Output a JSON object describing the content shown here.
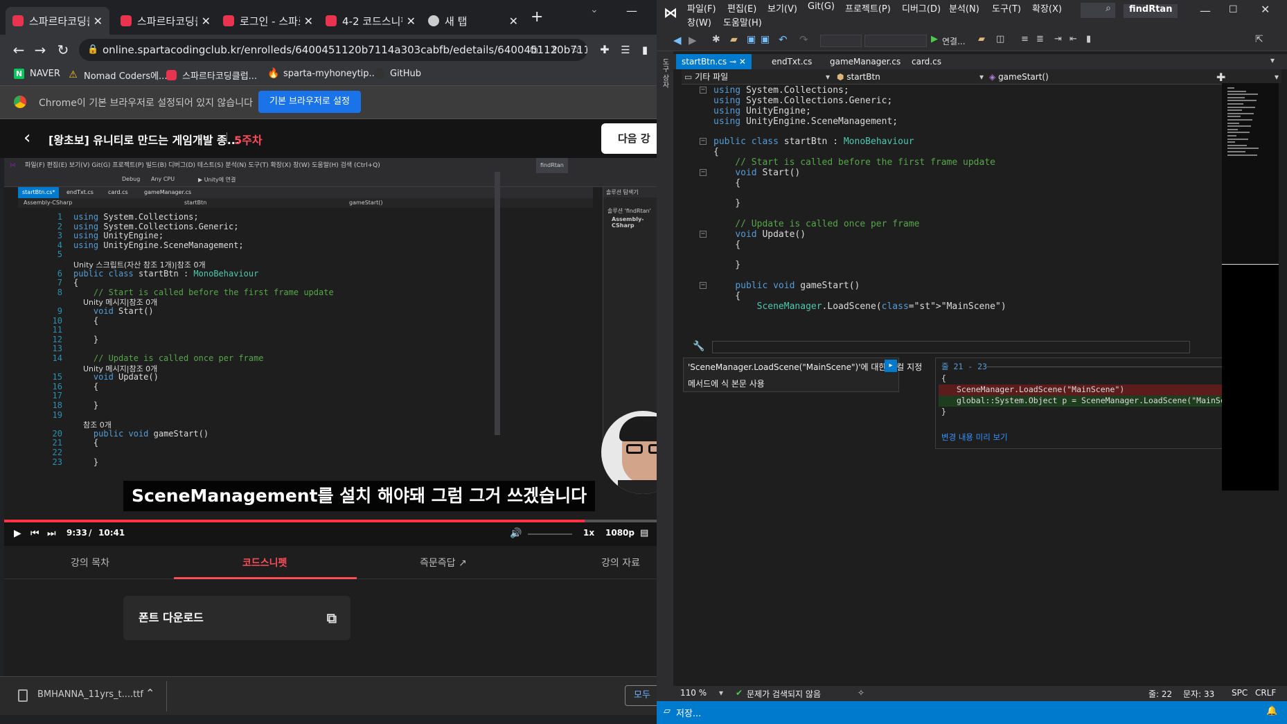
{
  "browser": {
    "tabs": [
      {
        "title": "스파르타코딩클"
      },
      {
        "title": "스파르타코딩클"
      },
      {
        "title": "로그인 - 스파르"
      },
      {
        "title": "4-2 코드스니펫"
      },
      {
        "title": "새 탭"
      }
    ],
    "url": "online.spartacodingclub.kr/enrolleds/6400451120b7114a303cabfb/edetails/6400451120b711...",
    "bookmarks": [
      "NAVER",
      "Nomad Coders에...",
      "스파르타코딩클럽...",
      "sparta-myhoneytip...",
      "GitHub"
    ],
    "infobar_message": "Chrome이 기본 브라우저로 설정되어 있지 않습니다",
    "infobar_button": "기본 브라우저로 설정"
  },
  "lecture": {
    "title": "[왕초보] 유니티로 만드는 게임개발 종...",
    "week": "5주차",
    "next_label": "다음 강의",
    "subtitle": "SceneManagement를 설치 해야돼 그럼 그거 쓰겠습니다",
    "time_current": "9:33",
    "time_sep": "/",
    "time_total": "10:41",
    "progress": 0.89,
    "speed": "1x",
    "quality": "1080p",
    "tabs": [
      "강의 목차",
      "코드스니펫",
      "즉문즉답",
      "강의 자료"
    ],
    "active_tab": 1,
    "font_card": "폰트 다운로드",
    "download_file": "BMHANNA_11yrs_t....ttf",
    "show_all": "모두"
  },
  "video_vs": {
    "menu": "파일(F)  편집(E)  보기(V)  Git(G)  프로젝트(P)  빌드(B)  디버그(D)  테스트(S)  분석(N)  도구(T)  확장(X)  창(W)  도움말(H)   검색 (Ctrl+Q)",
    "project": "findRtan",
    "config": "Debug",
    "platform": "Any CPU",
    "attach": "Unity에 연결",
    "tabs": [
      "startBtn.cs*",
      "endTxt.cs",
      "card.cs",
      "gameManager.cs"
    ],
    "nav": [
      "Assembly-CSharp",
      "startBtn",
      "gameStart()"
    ],
    "side_title": "솔루션 탐색기",
    "side_items": [
      "솔루션 'findRtan'",
      "Assembly-CSharp"
    ],
    "lines": [
      {
        "n": "1",
        "t": "using System.Collections;"
      },
      {
        "n": "2",
        "t": "using System.Collections.Generic;"
      },
      {
        "n": "3",
        "t": "using UnityEngine;"
      },
      {
        "n": "4",
        "t": "using UnityEngine.SceneManagement;"
      },
      {
        "n": "5",
        "t": ""
      },
      {
        "n": "",
        "t": "Unity 스크립트(자산 참조 1개)|참조 0개"
      },
      {
        "n": "6",
        "t": "public class startBtn : MonoBehaviour"
      },
      {
        "n": "7",
        "t": "{"
      },
      {
        "n": "8",
        "t": "    // Start is called before the first frame update"
      },
      {
        "n": "",
        "t": "    Unity 메시지|참조 0개"
      },
      {
        "n": "9",
        "t": "    void Start()"
      },
      {
        "n": "10",
        "t": "    {"
      },
      {
        "n": "11",
        "t": ""
      },
      {
        "n": "12",
        "t": "    }"
      },
      {
        "n": "13",
        "t": ""
      },
      {
        "n": "14",
        "t": "    // Update is called once per frame"
      },
      {
        "n": "",
        "t": "    Unity 메시지|참조 0개"
      },
      {
        "n": "15",
        "t": "    void Update()"
      },
      {
        "n": "16",
        "t": "    {"
      },
      {
        "n": "17",
        "t": ""
      },
      {
        "n": "18",
        "t": "    }"
      },
      {
        "n": "19",
        "t": ""
      },
      {
        "n": "",
        "t": "    참조 0개"
      },
      {
        "n": "20",
        "t": "    public void gameStart()"
      },
      {
        "n": "21",
        "t": "    {"
      },
      {
        "n": "22",
        "t": ""
      },
      {
        "n": "23",
        "t": "    }"
      }
    ]
  },
  "vs": {
    "menu": [
      "파일(F)",
      "편집(E)",
      "보기(V)",
      "Git(G)",
      "프로젝트(P)",
      "디버그(D)",
      "분석(N)",
      "도구(T)",
      "확장(X)",
      "창(W)",
      "도움말(H)"
    ],
    "project": "findRtan",
    "attach": "연결...",
    "tabs": [
      "startBtn.cs",
      "endTxt.cs",
      "gameManager.cs",
      "card.cs"
    ],
    "nav": [
      "기타 파일",
      "startBtn",
      "gameStart()"
    ],
    "lines": [
      "using System.Collections;",
      "using System.Collections.Generic;",
      "using UnityEngine;",
      "using UnityEngine.SceneManagement;",
      "",
      "public class startBtn : MonoBehaviour",
      "{",
      "    // Start is called before the first frame update",
      "    void Start()",
      "    {",
      "",
      "    }",
      "",
      "    // Update is called once per frame",
      "    void Update()",
      "    {",
      "",
      "    }",
      "",
      "    public void gameStart()",
      "    {",
      "        SceneManager.LoadScene(\"MainScene\")"
    ],
    "quick_actions": [
      "'SceneManager.LoadScene(\"MainScene\")'에 대한 로컬 지정",
      "메서드에 식 본문 사용"
    ],
    "preview_header": "줄 21 - 23",
    "preview_lines": [
      "{",
      "SceneManager.LoadScene(\"MainScene\")",
      "global::System.Object p = SceneManager.LoadScene(\"MainScene",
      "}"
    ],
    "preview_link": "변경 내용 미리 보기",
    "zoom": "110 %",
    "issues": "문제가 검색되지 않음",
    "line": "줄: 22",
    "char": "문자: 33",
    "spc": "SPC",
    "eol": "CRLF",
    "status": "저장..."
  },
  "colors": {
    "accent": "#ff4d5a",
    "vs_blue": "#007acc",
    "chrome_blue": "#1a73e8"
  }
}
